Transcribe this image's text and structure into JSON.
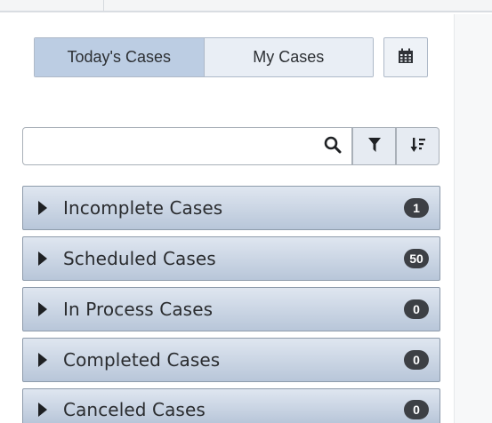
{
  "tabs": [
    {
      "label": "Today's Cases",
      "active": true
    },
    {
      "label": "My Cases",
      "active": false
    }
  ],
  "icons": {
    "calendar": "calendar-icon",
    "search": "search-icon",
    "filter": "filter-icon",
    "sort": "sort-icon",
    "caret": "caret-right-icon"
  },
  "search": {
    "value": "",
    "placeholder": ""
  },
  "groups": [
    {
      "label": "Incomplete Cases",
      "count": "1"
    },
    {
      "label": "Scheduled Cases",
      "count": "50"
    },
    {
      "label": "In Process Cases",
      "count": "0"
    },
    {
      "label": "Completed Cases",
      "count": "0"
    },
    {
      "label": "Canceled Cases",
      "count": "0"
    }
  ],
  "colors": {
    "tab_active": "#bccde3",
    "tab_inactive": "#e9eef5",
    "group_bar": "#c9d5e5",
    "badge": "#3d4045"
  }
}
